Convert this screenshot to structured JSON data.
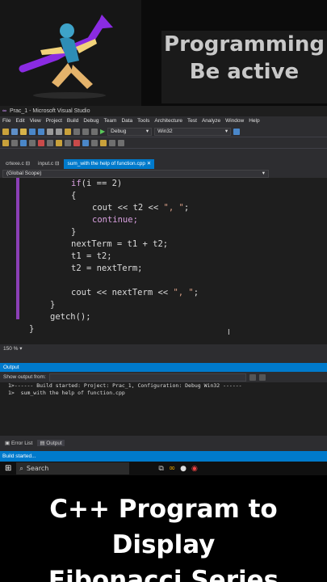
{
  "banner": {
    "line1": "Programming",
    "line2": "Be active"
  },
  "window": {
    "title": "Prac_1 - Microsoft Visual Studio"
  },
  "menu": [
    "File",
    "Edit",
    "View",
    "Project",
    "Build",
    "Debug",
    "Team",
    "Data",
    "Tools",
    "Architecture",
    "Test",
    "Analyze",
    "Window",
    "Help"
  ],
  "toolbar": {
    "config": "Debug",
    "platform": "Win32"
  },
  "tabs": [
    {
      "label": "crtexe.c"
    },
    {
      "label": "input.c"
    },
    {
      "label": "sum_with the help of function.cpp",
      "active": true
    }
  ],
  "scope": "(Global Scope)",
  "code": [
    "if(i == 2)",
    "{",
    "cout << t2 << \", \";",
    "continue;",
    "}",
    "nextTerm = t1 + t2;",
    "t1 = t2;",
    "t2 = nextTerm;",
    "cout << nextTerm << \", \";",
    "}",
    "getch();",
    "}"
  ],
  "zoom": "150 %",
  "output": {
    "header": "Output",
    "show_from_label": "Show output from:",
    "lines": [
      "1>------ Build started: Project: Prac_1, Configuration: Debug Win32 ------",
      "1>  sum_with the help of function.cpp"
    ]
  },
  "bottom_tabs": [
    "Error List",
    "Output"
  ],
  "status": "Build started...",
  "taskbar": {
    "search_placeholder": "Search"
  },
  "caption": {
    "line1": "C++ Program to Display",
    "line2": "Fibonacci Series"
  }
}
